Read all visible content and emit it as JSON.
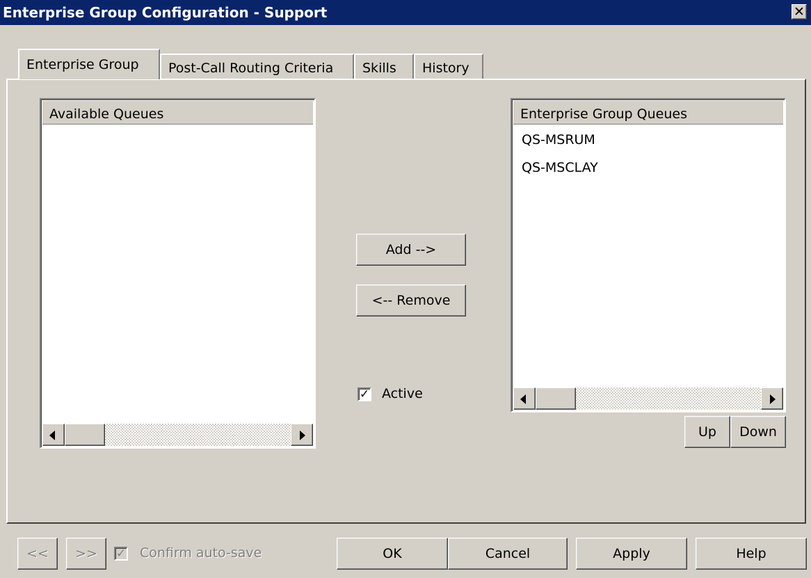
{
  "window": {
    "title": "Enterprise Group Configuration - Support",
    "close_glyph": "✕"
  },
  "tabs": [
    {
      "label": "Enterprise Group",
      "active": true
    },
    {
      "label": "Post-Call Routing Criteria",
      "active": false
    },
    {
      "label": "Skills",
      "active": false
    },
    {
      "label": "History",
      "active": false
    }
  ],
  "available_queues": {
    "header": "Available Queues",
    "items": []
  },
  "group_queues": {
    "header": "Enterprise Group Queues",
    "items": [
      "QS-MSRUM",
      "QS-MSCLAY"
    ]
  },
  "actions": {
    "add_label": "Add -->",
    "remove_label": "<-- Remove",
    "active_label": "Active",
    "active_checked": true
  },
  "order": {
    "up_label": "Up",
    "down_label": "Down"
  },
  "footer": {
    "prev_label": "<<",
    "next_label": ">>",
    "confirm_autosave_label": "Confirm auto-save",
    "confirm_autosave_checked": true,
    "ok_label": "OK",
    "cancel_label": "Cancel",
    "apply_label": "Apply",
    "help_label": "Help"
  }
}
